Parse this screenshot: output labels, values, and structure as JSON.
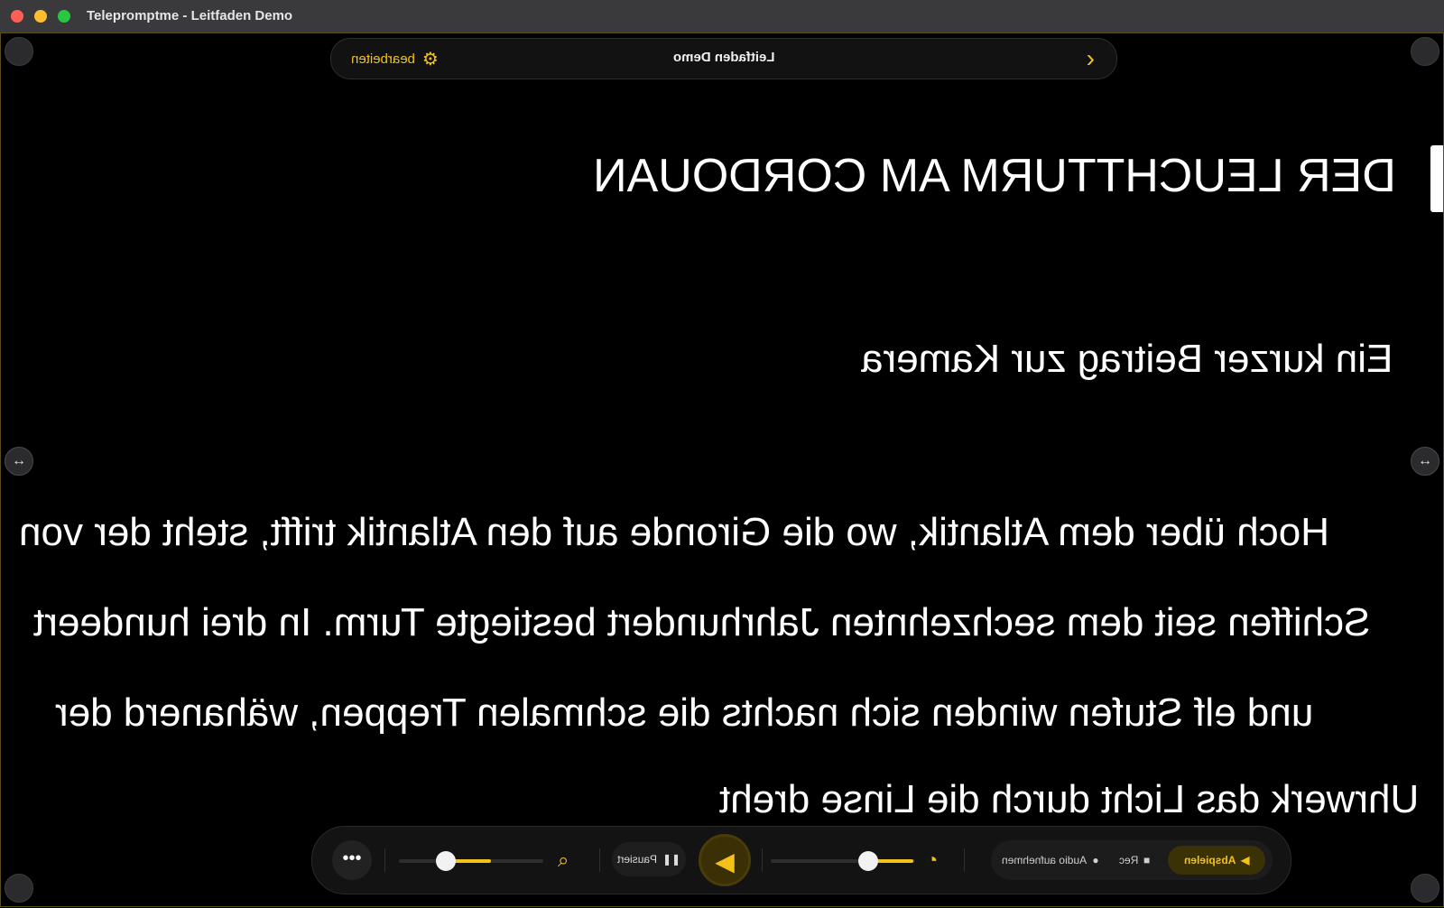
{
  "window": {
    "title": "Telepromptme - Leitfaden Demo"
  },
  "topbar": {
    "edit_label": "bearbeiten",
    "document_title": "Leitfaden Demo",
    "gear_icon": "gear-icon",
    "next_icon": "chevron-right-icon"
  },
  "script": {
    "heading": "DER LEUCHTTURM AM CORDOUAN",
    "subheading": "Ein kurzer Beitrag zur Kamera",
    "lines": [
      "Hoch über dem Atlantik, wo die Gironde auf den Atlantik trifft, steht der von",
      "Schiffen seit dem sechzehnten Jahrhundert bestiegte Turm. In drei hundeert",
      "und elf Stufen winden sich nachts die schmalen Treppen, wähanerd der",
      "Uhrwerk das Licht durch die Linse dreht"
    ]
  },
  "controls": {
    "more_label": "•••",
    "zoom_level": 0.7,
    "pause_label": "Pausiert",
    "play_icon": "play-icon",
    "speed_level": 0.3,
    "audio_label": "Audio aufnehmen",
    "record_label": "Rec",
    "playback_label": "Abspielen"
  },
  "colors": {
    "accent": "#f2c21b",
    "background": "#000000"
  }
}
